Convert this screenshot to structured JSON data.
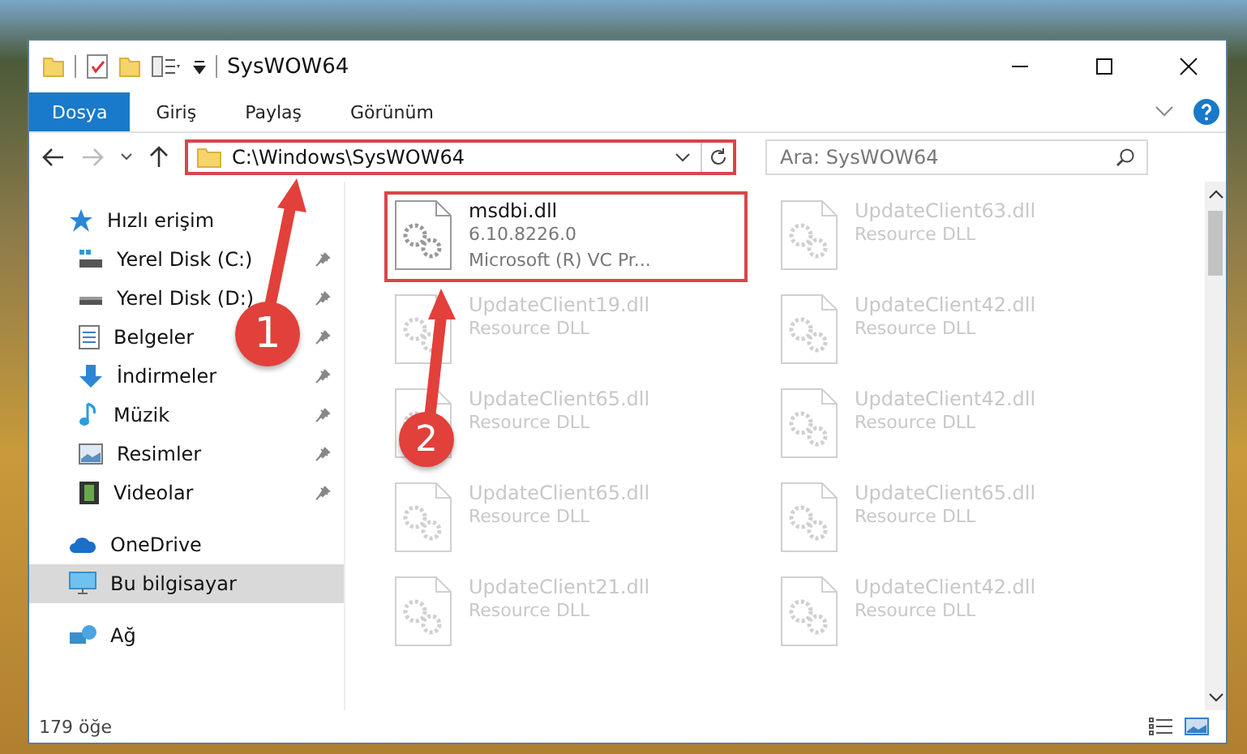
{
  "window": {
    "title": "SysWOW64"
  },
  "ribbon_tabs": [
    {
      "label": "Dosya",
      "selected": true
    },
    {
      "label": "Giriş",
      "selected": false
    },
    {
      "label": "Paylaş",
      "selected": false
    },
    {
      "label": "Görünüm",
      "selected": false
    }
  ],
  "address": {
    "value": "C:\\Windows\\SysWOW64",
    "highlighted": true
  },
  "search": {
    "placeholder": "Ara: SysWOW64"
  },
  "sidebar": {
    "items": [
      {
        "label": "Hızlı erişim",
        "kind": "star",
        "pinned": false,
        "sub": false,
        "selected": false
      },
      {
        "label": "Yerel Disk (C:)",
        "kind": "drive-c",
        "pinned": true,
        "sub": true,
        "selected": false
      },
      {
        "label": "Yerel Disk (D:)",
        "kind": "drive",
        "pinned": true,
        "sub": true,
        "selected": false
      },
      {
        "label": "Belgeler",
        "kind": "document",
        "pinned": true,
        "sub": true,
        "selected": false
      },
      {
        "label": "İndirmeler",
        "kind": "download",
        "pinned": true,
        "sub": true,
        "selected": false
      },
      {
        "label": "Müzik",
        "kind": "music",
        "pinned": true,
        "sub": true,
        "selected": false
      },
      {
        "label": "Resimler",
        "kind": "picture",
        "pinned": true,
        "sub": true,
        "selected": false
      },
      {
        "label": "Videolar",
        "kind": "video",
        "pinned": true,
        "sub": true,
        "selected": false
      },
      {
        "label": "OneDrive",
        "kind": "cloud",
        "pinned": false,
        "sub": false,
        "selected": false
      },
      {
        "label": "Bu bilgisayar",
        "kind": "computer",
        "pinned": false,
        "sub": false,
        "selected": true
      },
      {
        "label": "Ağ",
        "kind": "network",
        "pinned": false,
        "sub": false,
        "selected": false
      }
    ]
  },
  "files": [
    {
      "name": "msdbi.dll",
      "lines": [
        "6.10.8226.0",
        "Microsoft (R) VC Pr..."
      ],
      "blurred": false,
      "highlighted": true
    },
    {
      "name": "UpdateClient63.dll",
      "lines": [
        "Resource DLL"
      ],
      "blurred": true,
      "highlighted": false
    },
    {
      "name": "UpdateClient19.dll",
      "lines": [
        "Resource DLL"
      ],
      "blurred": true,
      "highlighted": false
    },
    {
      "name": "UpdateClient42.dll",
      "lines": [
        "Resource DLL"
      ],
      "blurred": true,
      "highlighted": false
    },
    {
      "name": "UpdateClient65.dll",
      "lines": [
        "Resource DLL"
      ],
      "blurred": true,
      "highlighted": false
    },
    {
      "name": "UpdateClient42.dll",
      "lines": [
        "Resource DLL"
      ],
      "blurred": true,
      "highlighted": false
    },
    {
      "name": "UpdateClient65.dll",
      "lines": [
        "Resource DLL"
      ],
      "blurred": true,
      "highlighted": false
    },
    {
      "name": "UpdateClient65.dll",
      "lines": [
        "Resource DLL"
      ],
      "blurred": true,
      "highlighted": false
    },
    {
      "name": "UpdateClient21.dll",
      "lines": [
        "Resource DLL"
      ],
      "blurred": true,
      "highlighted": false
    },
    {
      "name": "UpdateClient42.dll",
      "lines": [
        "Resource DLL"
      ],
      "blurred": true,
      "highlighted": false
    }
  ],
  "status_bar": {
    "count": "179 öğe"
  },
  "annotations": [
    {
      "number": "1"
    },
    {
      "number": "2"
    }
  ]
}
